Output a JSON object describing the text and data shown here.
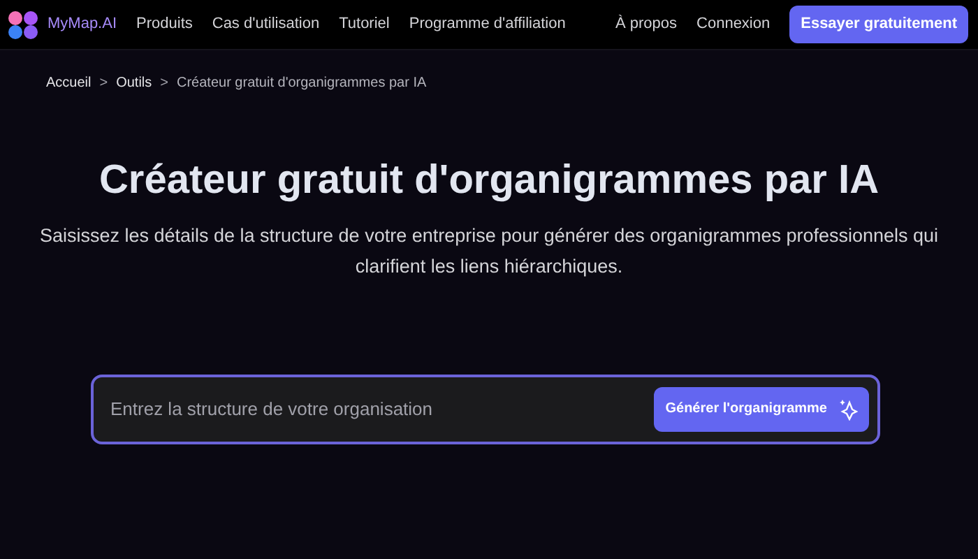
{
  "nav": {
    "brand": "MyMap.AI",
    "links": [
      "Produits",
      "Cas d'utilisation",
      "Tutoriel",
      "Programme d'affiliation"
    ],
    "right_links": [
      "À propos",
      "Connexion"
    ],
    "cta": "Essayer gratuitement"
  },
  "breadcrumb": [
    "Accueil",
    "Outils",
    "Créateur gratuit d'organigrammes par IA"
  ],
  "breadcrumb_separator": ">",
  "hero": {
    "title": "Créateur gratuit d'organigrammes par IA",
    "subtitle": "Saisissez les détails de la structure de votre entreprise pour générer des organigrammes professionnels qui clarifient les liens hiérarchiques."
  },
  "prompt": {
    "placeholder": "Entrez la structure de votre organisation",
    "button": "Générer l'organigramme"
  }
}
